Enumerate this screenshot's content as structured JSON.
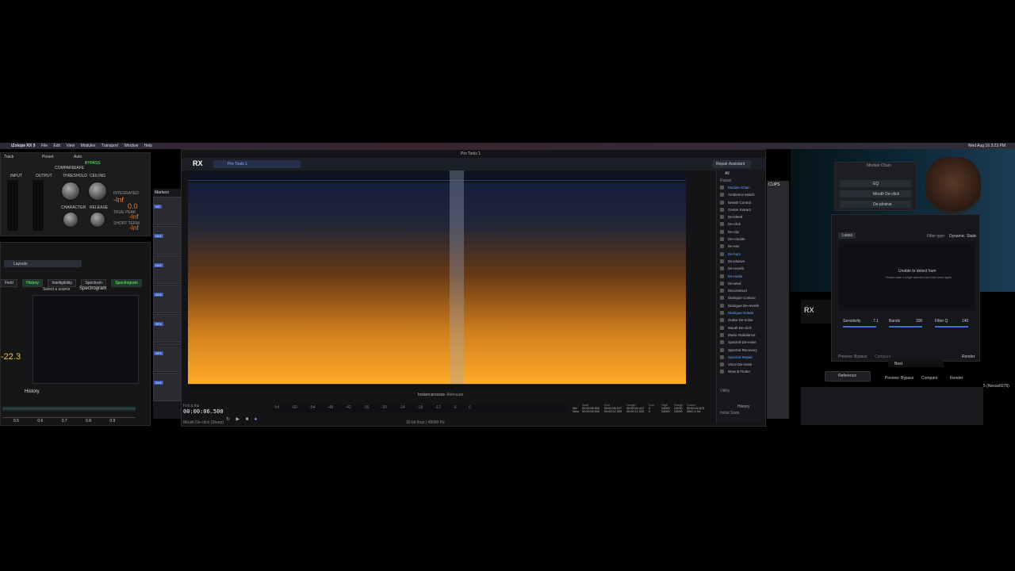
{
  "menubar": {
    "app": "iZotope RX 9",
    "items": [
      "File",
      "Edit",
      "View",
      "Modules",
      "Transport",
      "Window",
      "Help"
    ],
    "clock": "Wed Aug 16  3:23 PM"
  },
  "plugin": {
    "track_label": "Track",
    "preset_label": "Preset",
    "auto_label": "Auto",
    "compare": "COMPARE",
    "safe": "SAFE",
    "bypass": "BYPASS",
    "input_label": "INPUT",
    "output_label": "OUTPUT",
    "threshold_label": "THRESHOLD",
    "ceiling_label": "CEILING",
    "character_label": "CHARACTER",
    "release_label": "RELEASE",
    "integrated_label": "INTEGRATED",
    "true_peak_label": "TRUE PEAK",
    "short_term_label": "SHORT TERM",
    "integrated_val": "-Inf",
    "range_val": "0.0",
    "true_peak_val": "-Inf",
    "short_val": "-Inf"
  },
  "insight": {
    "preset": "Layouts",
    "tabs": [
      "Field",
      "History",
      "Intelligibility",
      "Spectrum",
      "Spectrogram"
    ],
    "source_select": "Select a source",
    "spectrogram_title": "Spectrogram",
    "loudness_value": "-22.3",
    "history_title": "History",
    "axis_ticks": [
      "0.5",
      "0.6",
      "0.7",
      "0.8",
      "0.9"
    ]
  },
  "protools": {
    "markers_label": "Markers",
    "tracks": [
      "VO",
      "DX1",
      "DX2",
      "DX3",
      "SFX",
      "SFX",
      "DX4",
      "DX5",
      "MX",
      "MX"
    ]
  },
  "rx": {
    "logo": "RX",
    "tab_name": "Pro Tools 1",
    "window_title": "Pro Tools 1",
    "repair_assistant": "Repair Assistant",
    "filter_all": "All",
    "section_repair": "Repair",
    "module_chain": "Module Chain",
    "modules": [
      {
        "name": "Ambience Match",
        "hl": false
      },
      {
        "name": "Breath Control",
        "hl": false
      },
      {
        "name": "Center Extract",
        "hl": false
      },
      {
        "name": "De-bleed",
        "hl": false
      },
      {
        "name": "De-click",
        "hl": false
      },
      {
        "name": "De-clip",
        "hl": false
      },
      {
        "name": "De-crackle",
        "hl": false
      },
      {
        "name": "De-ess",
        "hl": false
      },
      {
        "name": "De-hum",
        "hl": true
      },
      {
        "name": "De-plosive",
        "hl": false
      },
      {
        "name": "De-reverb",
        "hl": false
      },
      {
        "name": "De-rustle",
        "hl": true
      },
      {
        "name": "De-wind",
        "hl": false
      },
      {
        "name": "Deconstruct",
        "hl": false
      },
      {
        "name": "Dialogue Contour",
        "hl": false
      },
      {
        "name": "Dialogue De-reverb",
        "hl": false
      },
      {
        "name": "Dialogue Isolate",
        "hl": true
      },
      {
        "name": "Guitar De-noise",
        "hl": false
      },
      {
        "name": "Mouth De-click",
        "hl": false
      },
      {
        "name": "Music Rebalance",
        "hl": false
      },
      {
        "name": "Spectral De-noise",
        "hl": false
      },
      {
        "name": "Spectral Recovery",
        "hl": false
      },
      {
        "name": "Spectral Repair",
        "hl": true
      },
      {
        "name": "Voice De-noise",
        "hl": false
      },
      {
        "name": "Wow & Flutter",
        "hl": false
      }
    ],
    "utility_label": "Utility",
    "history_label": "History",
    "initial_state": "Initial State",
    "timecode": "00:00:06.500",
    "instant_process": "Instant process",
    "attenuate": "Attenuate",
    "status_left": "Mouth De-click (Sharp)",
    "bit_depth": "32-bit float | 48000 Hz",
    "sel_labels": {
      "start": "Start",
      "end": "End",
      "length": "Length",
      "low": "Low",
      "high": "High",
      "range": "Range",
      "cursor": "Cursor"
    },
    "sel_row": {
      "label": "Sel",
      "start": "00:00:06.500",
      "end": "00:00:06.917",
      "length": "00:00:00.417",
      "low": "0",
      "high": "24000",
      "range": "24000",
      "cursor": "00:00:02.673"
    },
    "view_row": {
      "label": "View",
      "start": "00:00:00.000",
      "end": "00:00:12.323",
      "length": "00:00:12.323",
      "low": "0",
      "high": "24000",
      "range": "24000",
      "cursor": "2841.4 Hz"
    },
    "time_format": "h:m:s.ms",
    "hz_label": "Hz",
    "meter_scale": [
      "-Inf",
      "-60",
      "-54",
      "-48",
      "-42",
      "-36",
      "-30",
      "-24",
      "-18",
      "-12",
      "-6",
      "0"
    ]
  },
  "right": {
    "clips_label": "CLIPS",
    "chain_title": "Module Chain",
    "chain": [
      "EQ",
      "Mouth De-click",
      "De-plosive"
    ],
    "lasso": "Lasso",
    "filter_type": "Filter type:",
    "dynamic": "Dynamic",
    "static": "Static",
    "hum_msg": "Unable to detect hum",
    "hum_sub": "Please make a longer selection and click Learn again.",
    "sensitivity": "Sensitivity",
    "sensitivity_val": "7.1",
    "bands": "Bands",
    "bands_val": "300",
    "filter_q": "Filter Q",
    "filter_q_val": "140",
    "preview": "Preview",
    "bypass": "Bypass",
    "compare": "Compare",
    "render": "Render",
    "reference": "Reference",
    "mode": "Best",
    "rx_connect": "RX Connect",
    "track_tag": "5 (Nexus6078)"
  }
}
